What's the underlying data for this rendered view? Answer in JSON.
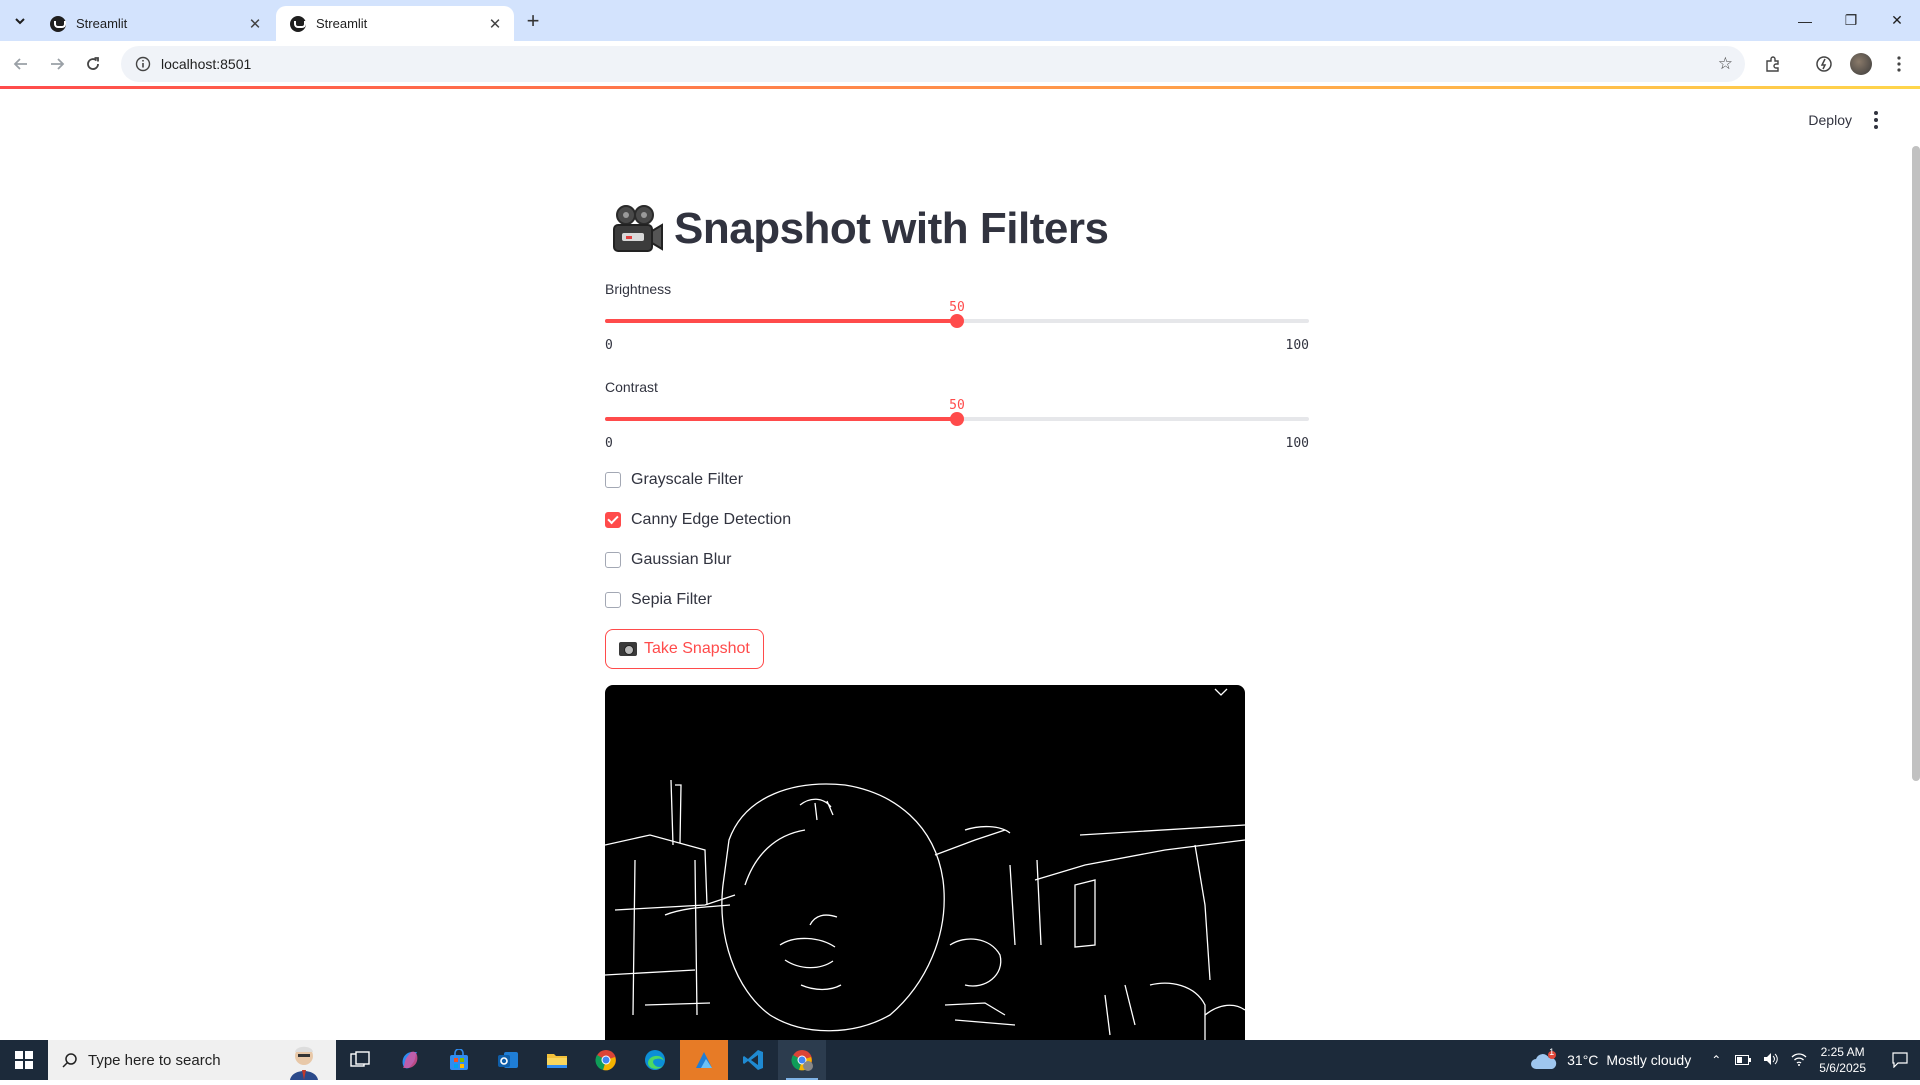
{
  "browser": {
    "tabs": [
      {
        "title": "Streamlit",
        "active": false
      },
      {
        "title": "Streamlit",
        "active": true
      }
    ],
    "url": "localhost:8501"
  },
  "header": {
    "deploy_label": "Deploy"
  },
  "app": {
    "title": "Snapshot with Filters",
    "sliders": [
      {
        "label": "Brightness",
        "value": "50",
        "min": "0",
        "max": "100",
        "fraction": 0.5
      },
      {
        "label": "Contrast",
        "value": "50",
        "min": "0",
        "max": "100",
        "fraction": 0.5
      }
    ],
    "checkboxes": [
      {
        "label": "Grayscale Filter",
        "checked": false
      },
      {
        "label": "Canny Edge Detection",
        "checked": true
      },
      {
        "label": "Gaussian Blur",
        "checked": false
      },
      {
        "label": "Sepia Filter",
        "checked": false
      }
    ],
    "snapshot_button_label": "Take Snapshot",
    "accent_color": "#ff4b4b"
  },
  "taskbar": {
    "search_placeholder": "Type here to search",
    "apps": [
      "task-view",
      "copilot",
      "microsoft-store",
      "outlook",
      "file-explorer",
      "chrome",
      "edge",
      "azure-data-studio",
      "vscode",
      "chrome-active"
    ],
    "weather_temp": "31°C",
    "weather_desc": "Mostly cloudy",
    "weather_badge": "1",
    "time": "2:25 AM",
    "date": "5/6/2025"
  }
}
